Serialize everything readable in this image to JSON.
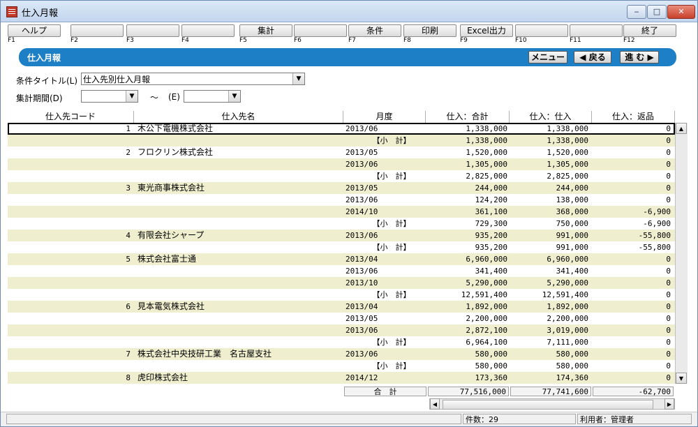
{
  "window": {
    "title": "仕入月報",
    "minimize": "‒",
    "maximize": "□",
    "close": "✕"
  },
  "fkeys": [
    {
      "label": "ヘルプ",
      "key": "F1"
    },
    {
      "label": "",
      "key": "F2"
    },
    {
      "label": "",
      "key": "F3"
    },
    {
      "label": "",
      "key": "F4"
    },
    {
      "label": "集計",
      "key": "F5"
    },
    {
      "label": "",
      "key": "F6"
    },
    {
      "label": "条件",
      "key": "F7"
    },
    {
      "label": "印刷",
      "key": "F8"
    },
    {
      "label": "Excel出力",
      "key": "F9"
    },
    {
      "label": "",
      "key": "F10"
    },
    {
      "label": "",
      "key": "F11"
    },
    {
      "label": "終了",
      "key": "F12"
    }
  ],
  "header_bar": {
    "title": "仕入月報",
    "menu": "メニュー",
    "back": "◀ 戻る",
    "forward": "進 む ▶"
  },
  "conditions": {
    "title_label": "条件タイトル(L)",
    "title_value": "仕入先別仕入月報",
    "period_label": "集計期間(D)",
    "period_from": "",
    "tilde": "～",
    "period_to_label": "(E)",
    "period_to": ""
  },
  "columns": [
    "仕入先コード",
    "仕入先名",
    "月度",
    "仕入：合計",
    "仕入：仕入",
    "仕入：返品"
  ],
  "rows": [
    {
      "code": "1",
      "name": "木公下電機株式会社",
      "month": "2013/06",
      "total": "1,338,000",
      "buy": "1,338,000",
      "ret": "0"
    },
    {
      "code": "",
      "name": "",
      "month": "　　　　【小　計】",
      "total": "1,338,000",
      "buy": "1,338,000",
      "ret": "0"
    },
    {
      "code": "2",
      "name": "フロクリン株式会社",
      "month": "2013/05",
      "total": "1,520,000",
      "buy": "1,520,000",
      "ret": "0"
    },
    {
      "code": "",
      "name": "",
      "month": "2013/06",
      "total": "1,305,000",
      "buy": "1,305,000",
      "ret": "0"
    },
    {
      "code": "",
      "name": "",
      "month": "　　　　【小　計】",
      "total": "2,825,000",
      "buy": "2,825,000",
      "ret": "0"
    },
    {
      "code": "3",
      "name": "東光商事株式会社",
      "month": "2013/05",
      "total": "244,000",
      "buy": "244,000",
      "ret": "0"
    },
    {
      "code": "",
      "name": "",
      "month": "2013/06",
      "total": "124,200",
      "buy": "138,000",
      "ret": "0"
    },
    {
      "code": "",
      "name": "",
      "month": "2014/10",
      "total": "361,100",
      "buy": "368,000",
      "ret": "-6,900"
    },
    {
      "code": "",
      "name": "",
      "month": "　　　　【小　計】",
      "total": "729,300",
      "buy": "750,000",
      "ret": "-6,900"
    },
    {
      "code": "4",
      "name": "有限会社シャープ",
      "month": "2013/06",
      "total": "935,200",
      "buy": "991,000",
      "ret": "-55,800"
    },
    {
      "code": "",
      "name": "",
      "month": "　　　　【小　計】",
      "total": "935,200",
      "buy": "991,000",
      "ret": "-55,800"
    },
    {
      "code": "5",
      "name": "株式会社富士通",
      "month": "2013/04",
      "total": "6,960,000",
      "buy": "6,960,000",
      "ret": "0"
    },
    {
      "code": "",
      "name": "",
      "month": "2013/06",
      "total": "341,400",
      "buy": "341,400",
      "ret": "0"
    },
    {
      "code": "",
      "name": "",
      "month": "2013/10",
      "total": "5,290,000",
      "buy": "5,290,000",
      "ret": "0"
    },
    {
      "code": "",
      "name": "",
      "month": "　　　　【小　計】",
      "total": "12,591,400",
      "buy": "12,591,400",
      "ret": "0"
    },
    {
      "code": "6",
      "name": "見本電気株式会社",
      "month": "2013/04",
      "total": "1,892,000",
      "buy": "1,892,000",
      "ret": "0"
    },
    {
      "code": "",
      "name": "",
      "month": "2013/05",
      "total": "2,200,000",
      "buy": "2,200,000",
      "ret": "0"
    },
    {
      "code": "",
      "name": "",
      "month": "2013/06",
      "total": "2,872,100",
      "buy": "3,019,000",
      "ret": "0"
    },
    {
      "code": "",
      "name": "",
      "month": "　　　　【小　計】",
      "total": "6,964,100",
      "buy": "7,111,000",
      "ret": "0"
    },
    {
      "code": "7",
      "name": "株式会社中央技研工業　名古屋支社",
      "month": "2013/06",
      "total": "580,000",
      "buy": "580,000",
      "ret": "0"
    },
    {
      "code": "",
      "name": "",
      "month": "　　　　【小　計】",
      "total": "580,000",
      "buy": "580,000",
      "ret": "0"
    },
    {
      "code": "8",
      "name": "虎印株式会社",
      "month": "2014/12",
      "total": "173,360",
      "buy": "174,360",
      "ret": "0"
    }
  ],
  "totals": {
    "label": "合　計",
    "total": "77,516,000",
    "buy": "77,741,600",
    "ret": "-62,700"
  },
  "status": {
    "count": "件数：29",
    "user": "利用者：管理者"
  }
}
